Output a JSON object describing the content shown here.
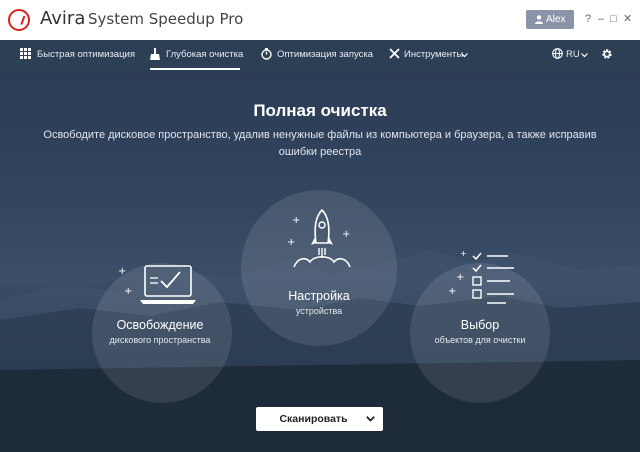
{
  "window": {
    "brand": "Avira",
    "product": "System Speedup Pro",
    "user_label": "Alex",
    "controls": {
      "help": "?",
      "minimize": "–",
      "maximize": "□",
      "close": "✕"
    }
  },
  "nav": {
    "items": [
      {
        "label": "Быстрая оптимизация",
        "icon": "grid-icon",
        "active": false
      },
      {
        "label": "Глубокая очистка",
        "icon": "broom-icon",
        "active": true
      },
      {
        "label": "Оптимизация запуска",
        "icon": "stopwatch-icon",
        "active": false
      },
      {
        "label": "Инструменты",
        "icon": "tools-icon",
        "active": false
      }
    ],
    "language": "RU"
  },
  "main": {
    "title": "Полная очистка",
    "subtitle": "Освободите дисковое пространство, удалив ненужные файлы из компьютера и браузера, а также исправив ошибки реестра",
    "cards": [
      {
        "title": "Освобождение",
        "subtitle": "дискового пространства",
        "icon": "laptop-check-icon"
      },
      {
        "title": "Настройка",
        "subtitle": "устройства",
        "icon": "rocket-icon"
      },
      {
        "title": "Выбор",
        "subtitle": "объектов для очистки",
        "icon": "checklist-icon"
      }
    ],
    "scan_button": "Сканировать"
  },
  "colors": {
    "accent_red": "#d7231f",
    "nav_background": "#2d3f55",
    "user_button": "#8a93a8"
  }
}
